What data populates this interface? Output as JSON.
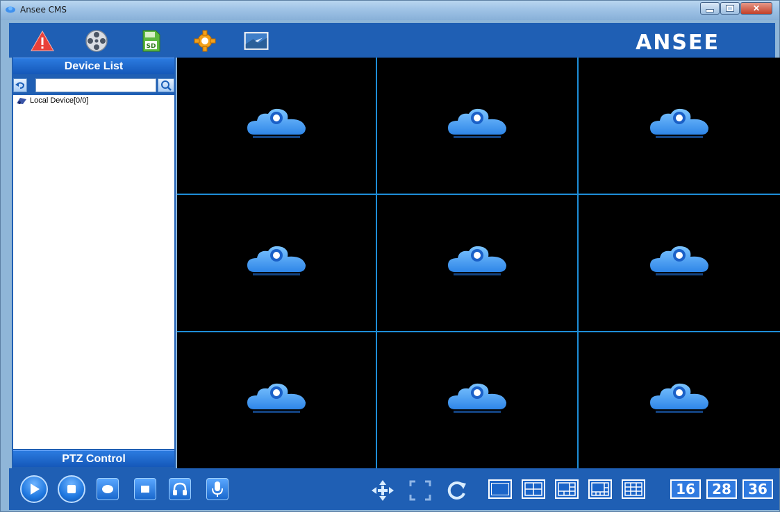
{
  "window": {
    "title": "Ansee CMS"
  },
  "toolbar": {
    "brand": "ANSEE",
    "icons": [
      "alarm-icon",
      "film-reel-icon",
      "sd-card-icon",
      "settings-gear-icon",
      "image-icon"
    ],
    "sd_label": "SD"
  },
  "device_panel": {
    "header": "Device List",
    "search_value": "",
    "tree": [
      {
        "label": "Local Device[0/0]"
      }
    ],
    "ptz_header": "PTZ Control"
  },
  "video_grid": {
    "rows": 3,
    "cols": 3,
    "cell_icon": "cloud-camera-icon"
  },
  "bottombar": {
    "playback": [
      "play-icon",
      "stop-icon",
      "record-icon",
      "snapshot-stop-icon",
      "headphones-icon",
      "microphone-icon"
    ],
    "view": [
      "ptz-move-icon",
      "fullscreen-icon",
      "refresh-icon"
    ],
    "layouts": [
      "1",
      "4",
      "6",
      "8",
      "9",
      "16",
      "28",
      "36"
    ],
    "layout_labels": {
      "l16": "16",
      "l28": "28",
      "l36": "36"
    }
  },
  "colors": {
    "toolbar_blue": "#1f5fb4",
    "grid_line": "#1e8ed8",
    "cloud": "#4aa3ff"
  }
}
